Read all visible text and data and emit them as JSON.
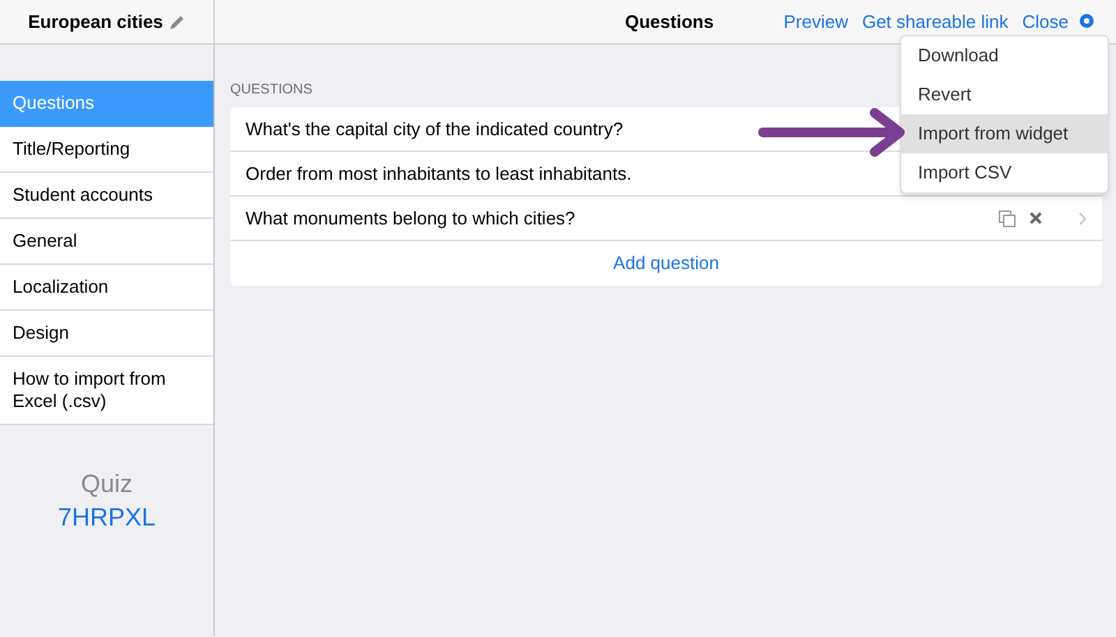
{
  "header": {
    "title": "European cities",
    "page_title": "Questions",
    "links": [
      "Preview",
      "Get shareable link",
      "Close"
    ]
  },
  "sidebar": {
    "items": [
      {
        "label": "Questions",
        "selected": true
      },
      {
        "label": "Title/Reporting",
        "selected": false
      },
      {
        "label": "Student accounts",
        "selected": false
      },
      {
        "label": "General",
        "selected": false
      },
      {
        "label": "Localization",
        "selected": false
      },
      {
        "label": "Design",
        "selected": false
      },
      {
        "label": "How to import from Excel (.csv)",
        "selected": false
      }
    ],
    "quiz_label": "Quiz",
    "quiz_code": "7HRPXL"
  },
  "questions": {
    "heading": "QUESTIONS",
    "rows": [
      {
        "text": "What's the capital city of the indicated country?"
      },
      {
        "text": "Order from most inhabitants to least inhabitants."
      },
      {
        "text": "What monuments belong to which cities?"
      }
    ],
    "add_button": "Add question"
  },
  "menu": {
    "items": [
      {
        "label": "Download",
        "selected": false
      },
      {
        "label": "Revert",
        "selected": false
      },
      {
        "label": "Import from widget",
        "selected": true
      },
      {
        "label": "Import CSV",
        "selected": false
      }
    ]
  }
}
